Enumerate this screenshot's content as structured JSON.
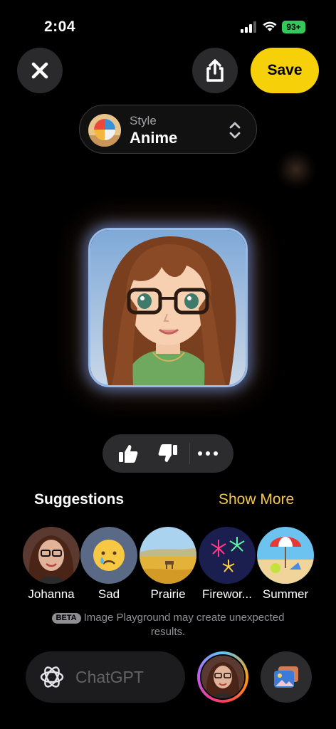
{
  "status_bar": {
    "time": "2:04",
    "battery": "93+"
  },
  "toolbar": {
    "close_icon": "xmark-icon",
    "share_icon": "share-icon",
    "save_label": "Save"
  },
  "style_picker": {
    "caption": "Style",
    "value": "Anime"
  },
  "feedback": {
    "like_icon": "thumbs-up-icon",
    "dislike_icon": "thumbs-down-icon",
    "more_icon": "ellipsis-icon"
  },
  "suggestions": {
    "title": "Suggestions",
    "show_more": "Show More",
    "items": [
      {
        "label": "Johanna"
      },
      {
        "label": "Sad"
      },
      {
        "label": "Prairie"
      },
      {
        "label": "Firewor..."
      },
      {
        "label": "Summer"
      }
    ]
  },
  "disclaimer": {
    "badge": "BETA",
    "text": "Image Playground may create unexpected results."
  },
  "prompt": {
    "placeholder": "ChatGPT"
  },
  "colors": {
    "accent": "#f6d10a",
    "show_more": "#f6c94a",
    "background": "#000000"
  }
}
